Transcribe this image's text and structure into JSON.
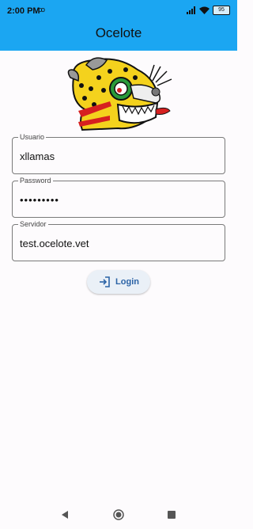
{
  "status_bar": {
    "time": "2:00 PM",
    "vm_icon": "voicemail-icon",
    "battery": "95"
  },
  "app_bar": {
    "title": "Ocelote",
    "color": "#1ba6f2"
  },
  "logo": {
    "name": "ocelote-jaguar-logo"
  },
  "form": {
    "username": {
      "label": "Usuario",
      "value": "xllamas"
    },
    "password": {
      "label": "Password",
      "value": "•••••••••"
    },
    "server": {
      "label": "Servidor",
      "value": "test.ocelote.vet"
    }
  },
  "login_button": {
    "label": "Login",
    "icon": "login-icon"
  },
  "nav": {
    "back": "back-icon",
    "home": "home-icon",
    "recents": "recents-icon"
  }
}
